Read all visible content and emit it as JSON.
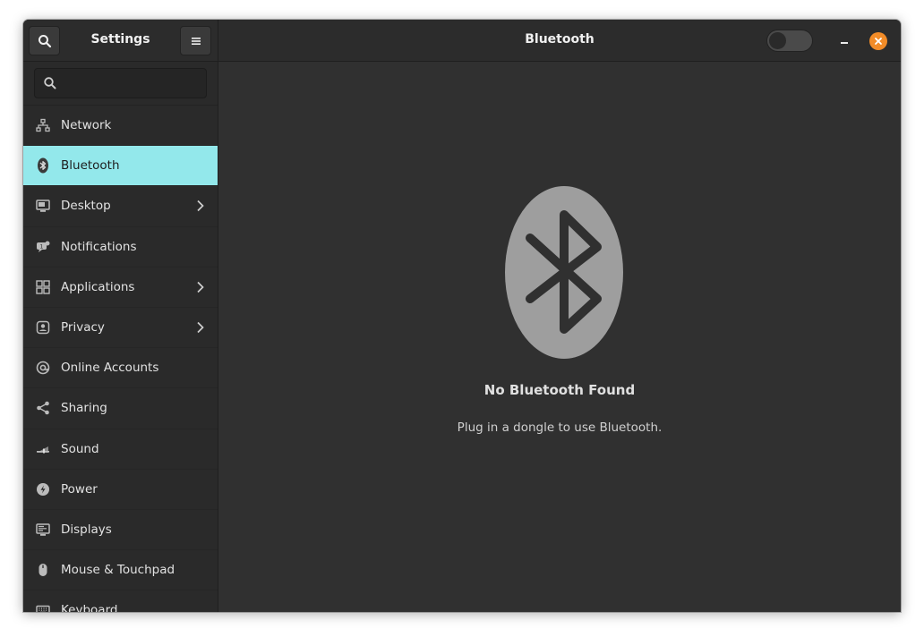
{
  "sidebar": {
    "title": "Settings",
    "search_placeholder": "",
    "items": [
      {
        "label": "Network",
        "icon": "network-icon",
        "chevron": false,
        "active": false
      },
      {
        "label": "Bluetooth",
        "icon": "bluetooth-icon",
        "chevron": false,
        "active": true
      },
      {
        "label": "Desktop",
        "icon": "desktop-icon",
        "chevron": true,
        "active": false
      },
      {
        "label": "Notifications",
        "icon": "notifications-icon",
        "chevron": false,
        "active": false
      },
      {
        "label": "Applications",
        "icon": "applications-icon",
        "chevron": true,
        "active": false
      },
      {
        "label": "Privacy",
        "icon": "privacy-icon",
        "chevron": true,
        "active": false
      },
      {
        "label": "Online Accounts",
        "icon": "at-sign-icon",
        "chevron": false,
        "active": false
      },
      {
        "label": "Sharing",
        "icon": "share-icon",
        "chevron": false,
        "active": false
      },
      {
        "label": "Sound",
        "icon": "sound-icon",
        "chevron": false,
        "active": false
      },
      {
        "label": "Power",
        "icon": "power-icon",
        "chevron": false,
        "active": false
      },
      {
        "label": "Displays",
        "icon": "display-icon",
        "chevron": false,
        "active": false
      },
      {
        "label": "Mouse & Touchpad",
        "icon": "mouse-icon",
        "chevron": false,
        "active": false
      },
      {
        "label": "Keyboard",
        "icon": "keyboard-icon",
        "chevron": false,
        "active": false
      }
    ]
  },
  "header": {
    "title": "Bluetooth",
    "toggle_on": false
  },
  "content": {
    "empty_title": "No Bluetooth Found",
    "empty_description": "Plug in a dongle to use Bluetooth."
  },
  "colors": {
    "accent": "#93e8eb",
    "close_button": "#f28c28",
    "background": "#303030"
  }
}
